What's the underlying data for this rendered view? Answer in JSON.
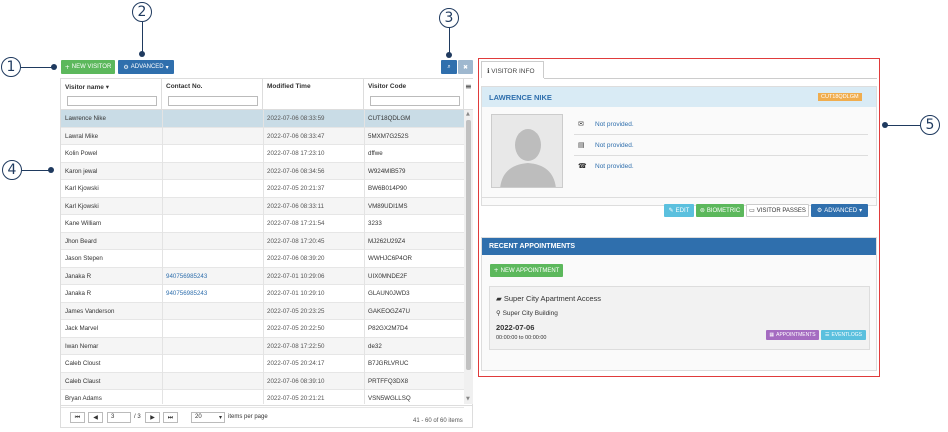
{
  "callouts": [
    "1",
    "2",
    "3",
    "4",
    "5"
  ],
  "toolbar": {
    "new_visitor": "NEW VISITOR",
    "advanced": "ADVANCED",
    "search_icon": "search-icon",
    "clear_icon": "close-icon"
  },
  "grid": {
    "columns": [
      "Visitor name",
      "Contact No.",
      "Modified Time",
      "Visitor Code"
    ],
    "rows": [
      {
        "name": "Lawrence Nike",
        "contact": "",
        "time": "2022-07-06 08:33:59",
        "code": "CUT18QDLGM"
      },
      {
        "name": "Lawral Mike",
        "contact": "",
        "time": "2022-07-06 08:33:47",
        "code": "5MXM7G252S"
      },
      {
        "name": "Kolin Powel",
        "contact": "",
        "time": "2022-07-08 17:23:10",
        "code": "dffwe"
      },
      {
        "name": "Karon jewal",
        "contact": "",
        "time": "2022-07-06 08:34:56",
        "code": "W924MIB579"
      },
      {
        "name": "Karl Kjowski",
        "contact": "",
        "time": "2022-07-05 20:21:37",
        "code": "BW6B014P90"
      },
      {
        "name": "Karl Kjowski",
        "contact": "",
        "time": "2022-07-06 08:33:11",
        "code": "VM89UDI1MS"
      },
      {
        "name": "Kane William",
        "contact": "",
        "time": "2022-07-08 17:21:54",
        "code": "3233"
      },
      {
        "name": "Jhon Beard",
        "contact": "",
        "time": "2022-07-08 17:20:45",
        "code": "MJ262U29Z4"
      },
      {
        "name": "Jason Stepen",
        "contact": "",
        "time": "2022-07-06 08:39:20",
        "code": "WWHJC6P4OR"
      },
      {
        "name": "Janaka R",
        "contact": "940756985243",
        "time": "2022-07-01 10:29:06",
        "code": "UIX0MNDE2F"
      },
      {
        "name": "Janaka R",
        "contact": "940756985243",
        "time": "2022-07-01 10:29:10",
        "code": "GLAUN0JWD3"
      },
      {
        "name": "James Vanderson",
        "contact": "",
        "time": "2022-07-05 20:23:25",
        "code": "GAKEOGZ47U"
      },
      {
        "name": "Jack Marvel",
        "contact": "",
        "time": "2022-07-05 20:22:50",
        "code": "P82GX2M7D4"
      },
      {
        "name": "Iwan Nemar",
        "contact": "",
        "time": "2022-07-08 17:22:50",
        "code": "de32"
      },
      {
        "name": "Caleb Cloust",
        "contact": "",
        "time": "2022-07-05 20:24:17",
        "code": "B7JGRLVRUC"
      },
      {
        "name": "Caleb Claust",
        "contact": "",
        "time": "2022-07-06 08:39:10",
        "code": "PRTFFQ3DX8"
      },
      {
        "name": "Bryan Adams",
        "contact": "",
        "time": "2022-07-05 20:21:21",
        "code": "VSN5WGLLSQ"
      }
    ],
    "pager": {
      "page": "3",
      "of": "/ 3",
      "per_page": "20",
      "per_page_label": "items per page",
      "summary": "41 - 60 of 60 items"
    }
  },
  "visitor": {
    "tab": "VISITOR INFO",
    "name": "LAWRENCE NIKE",
    "code": "CUT18QDLGM",
    "email": "Not provided.",
    "id": "Not provided.",
    "phone": "Not provided.",
    "edit": "EDIT",
    "biometric": "BIOMETRIC",
    "passes": "VISITOR PASSES",
    "advanced": "ADVANCED"
  },
  "appointments": {
    "title": "RECENT APPOINTMENTS",
    "new": "NEW APPOINTMENT",
    "item_title": "Super City Apartment Access",
    "location": "Super City Building",
    "date": "2022-07-06",
    "time": "00:00:00 to 00:00:00",
    "btn_appointments": "APPOINTMENTS",
    "btn_eventlogs": "EVENTLOGS"
  },
  "colors": {
    "accent": "#2f6fad",
    "green": "#5cb85c",
    "orange": "#f0ad4e",
    "highlight": "#e03b3b"
  }
}
